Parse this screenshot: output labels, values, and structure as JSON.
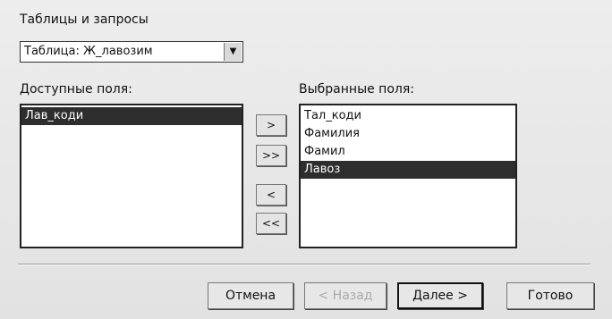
{
  "tables_label": "Таблицы и запросы",
  "table_select": {
    "value": "Таблица: Ж_лавозим",
    "arrow": "▼"
  },
  "available_label": "Доступные поля:",
  "selected_label": "Выбранные поля:",
  "available_fields": [
    "Лав_коди"
  ],
  "selected_fields": [
    "Тал_коди",
    "Фамилия",
    "Фамил",
    "Лавоз"
  ],
  "move_buttons": {
    "one_right": ">",
    "all_right": ">>",
    "one_left": "<",
    "all_left": "<<"
  },
  "buttons": {
    "cancel": "Отмена",
    "back": "< Назад",
    "next": "Далее >",
    "finish": "Готово"
  },
  "colors": {
    "selection": "#2e2e2e",
    "background": "#e9e9e9"
  }
}
